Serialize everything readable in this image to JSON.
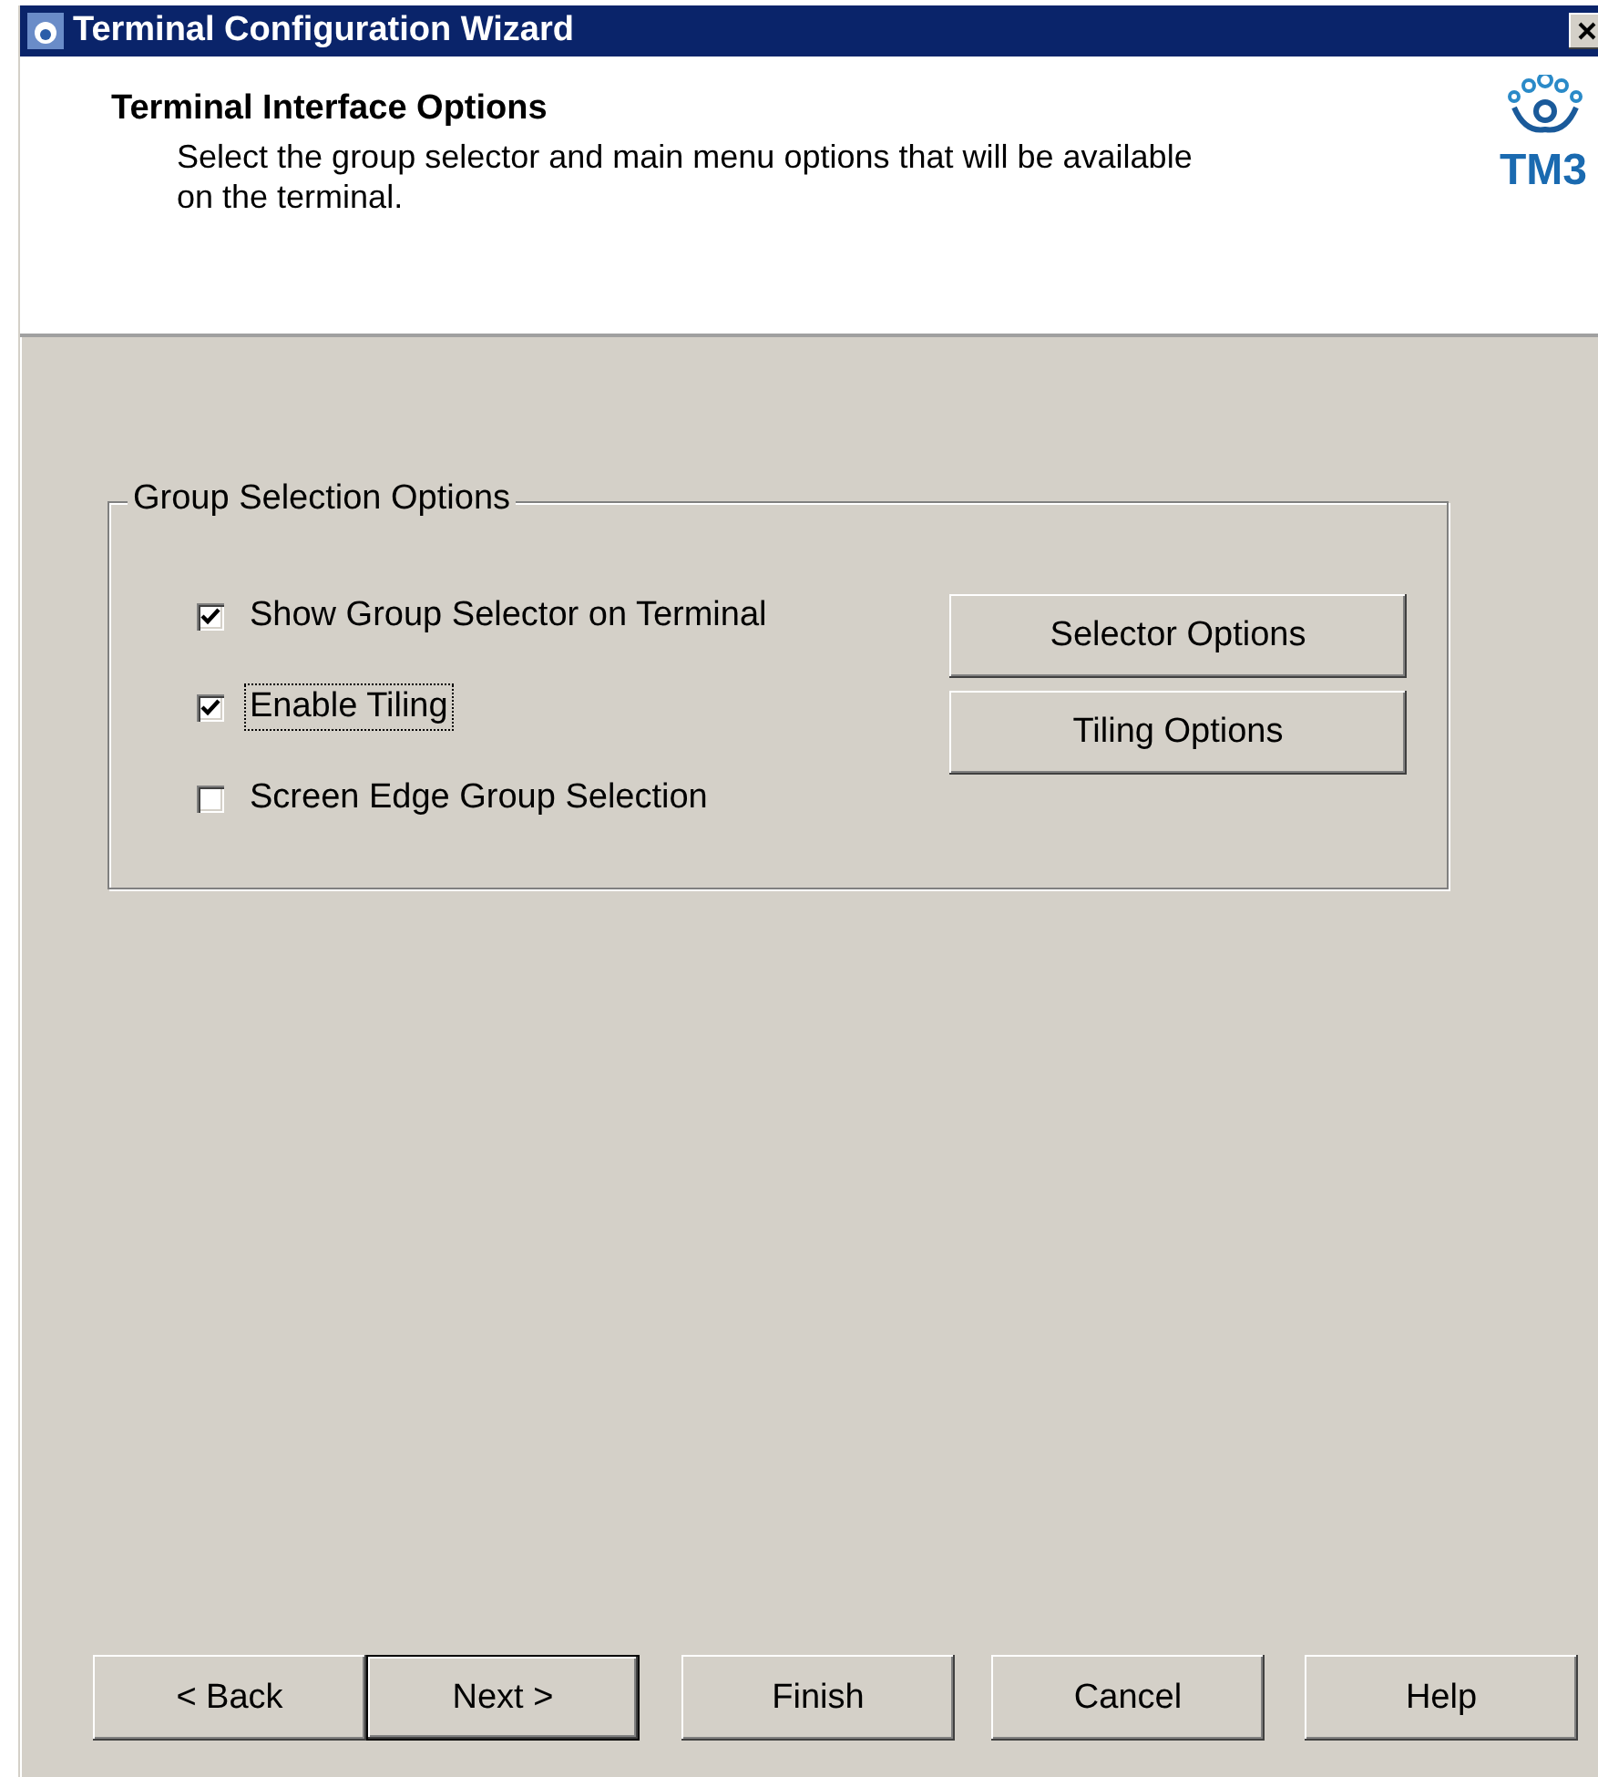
{
  "window": {
    "title": "Terminal Configuration Wizard"
  },
  "header": {
    "title": "Terminal Interface Options",
    "description": "Select the group selector and main menu options that will be available on the terminal.",
    "logo_text": "TM3"
  },
  "group": {
    "label": "Group Selection Options",
    "checkboxes": [
      {
        "label": "Show Group Selector on Terminal",
        "checked": true,
        "focused": false
      },
      {
        "label": "Enable Tiling",
        "checked": true,
        "focused": true
      },
      {
        "label": "Screen Edge Group Selection",
        "checked": false,
        "focused": false
      }
    ],
    "buttons": [
      {
        "label": "Selector Options"
      },
      {
        "label": "Tiling Options"
      }
    ]
  },
  "footer_buttons": [
    {
      "label": "< Back",
      "default": false
    },
    {
      "label": "Next >",
      "default": true
    },
    {
      "label": "Finish",
      "default": false
    },
    {
      "label": "Cancel",
      "default": false
    },
    {
      "label": "Help",
      "default": false
    }
  ]
}
